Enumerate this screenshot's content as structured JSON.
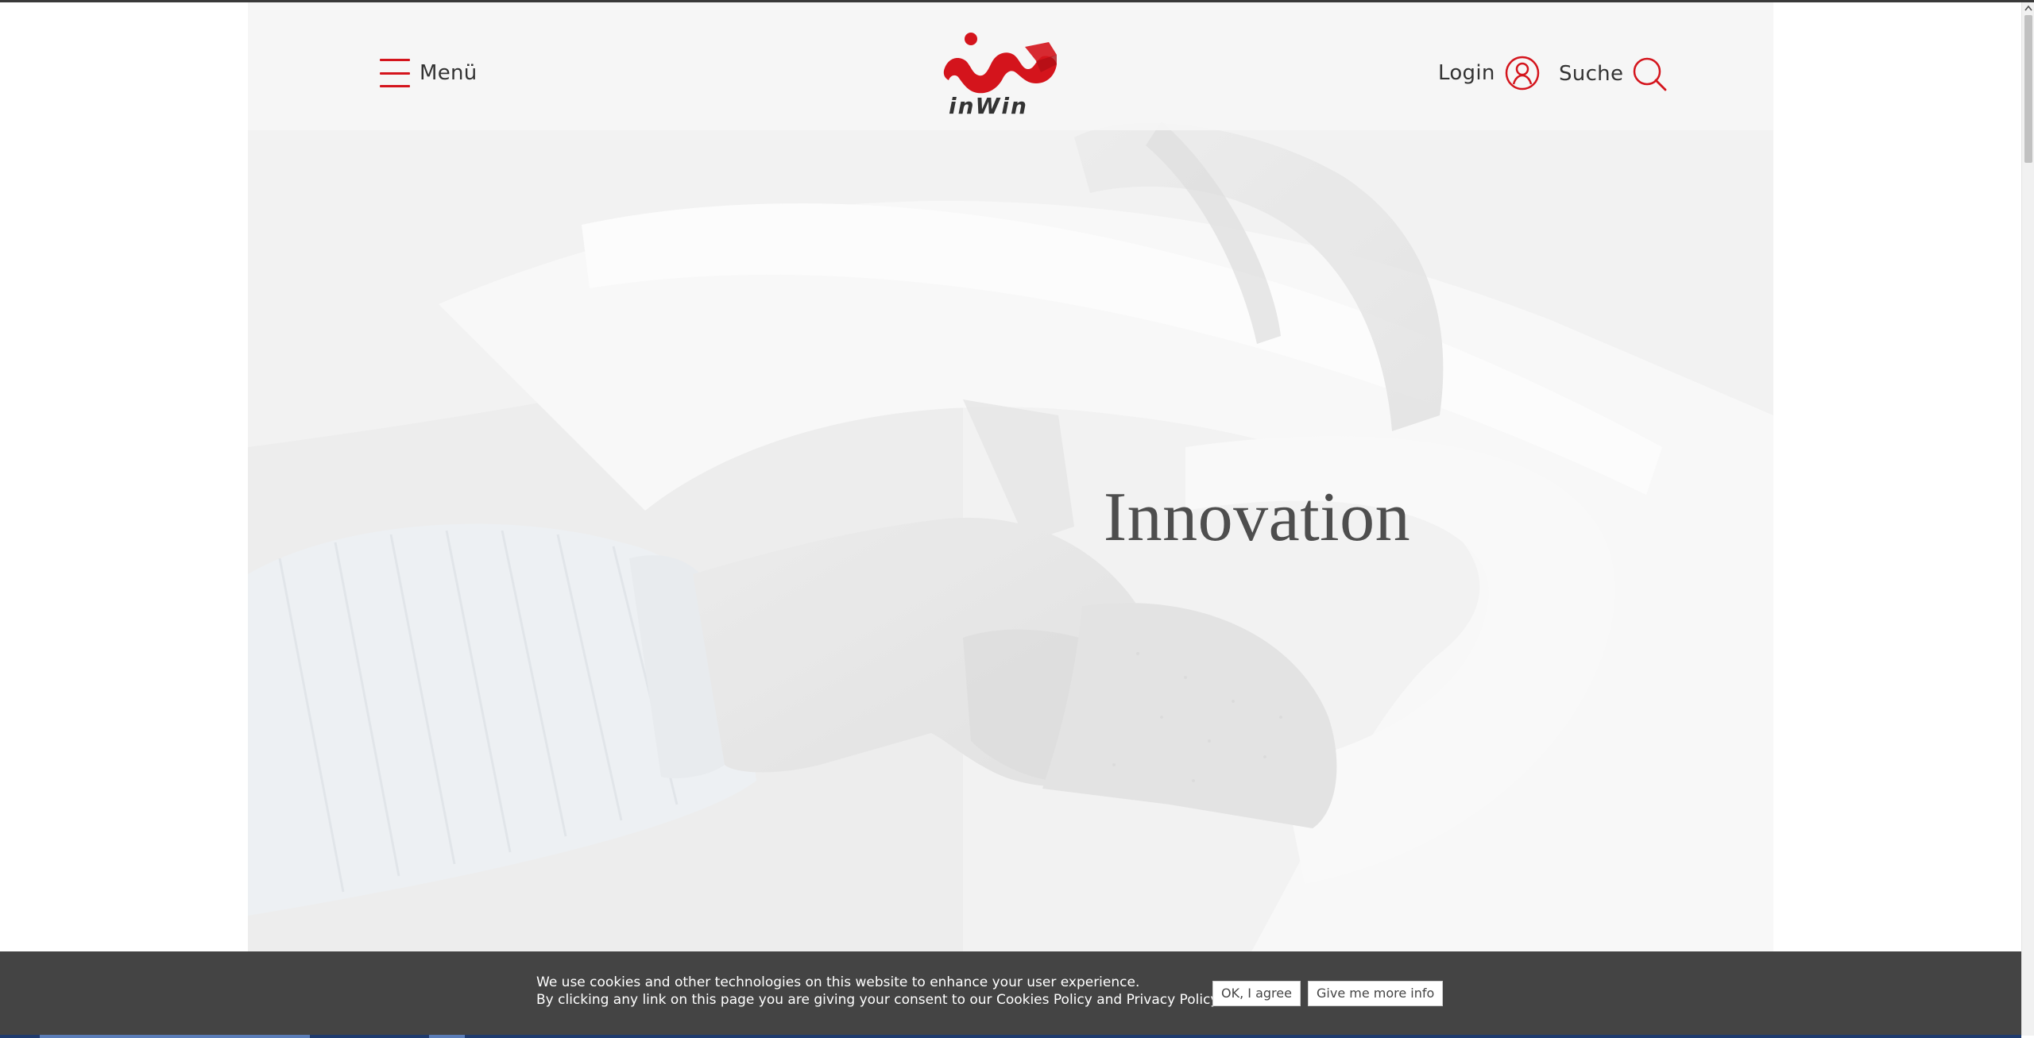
{
  "header": {
    "menu_label": "Menü",
    "brand": "InWin",
    "login_label": "Login",
    "search_label": "Suche"
  },
  "hero": {
    "title": "Innovation"
  },
  "cookie_bar": {
    "line1": "We use cookies and other technologies on this website to enhance your user experience.",
    "line2": "By clicking any link on this page you are giving your consent to our Cookies Policy and Privacy Policy.",
    "agree_label": "OK, I agree",
    "more_info_label": "Give me more info"
  },
  "icons": {
    "menu": "hamburger-icon",
    "login": "user-icon",
    "search": "magnifier-icon",
    "scroll_up": "chevron-up-icon"
  },
  "colors": {
    "accent": "#d4141c",
    "cookie_background": "#3c3c3c",
    "hero_title": "#4e4e4e"
  }
}
